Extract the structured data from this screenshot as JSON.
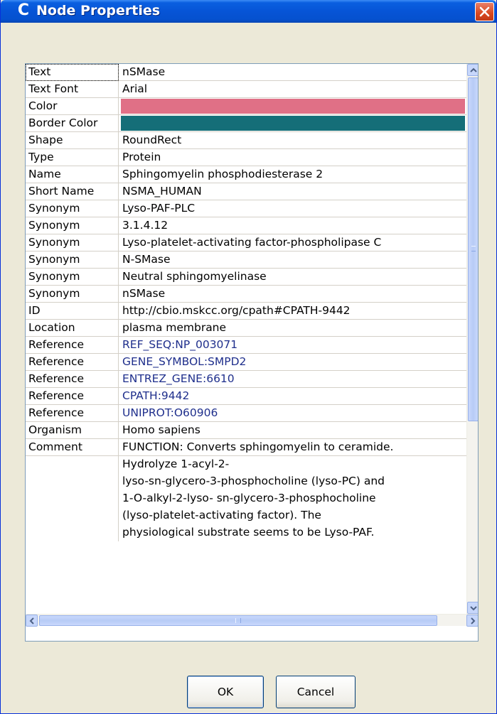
{
  "window": {
    "title": "Node Properties",
    "app_icon_glyph": "C",
    "close_glyph_name": "close-icon"
  },
  "colors": {
    "node_color": "#e07086",
    "border_color": "#156e78",
    "reference_text": "#1f2f8c",
    "titlebar": "#0654d6"
  },
  "properties": [
    {
      "key": "Text",
      "value": "nSMase"
    },
    {
      "key": "Text Font",
      "value": "Arial"
    },
    {
      "key": "Color",
      "value": ""
    },
    {
      "key": "Border Color",
      "value": ""
    },
    {
      "key": "Shape",
      "value": "RoundRect"
    },
    {
      "key": "Type",
      "value": "Protein"
    },
    {
      "key": "Name",
      "value": "Sphingomyelin phosphodiesterase 2"
    },
    {
      "key": "Short Name",
      "value": "NSMA_HUMAN"
    },
    {
      "key": "Synonym",
      "value": "Lyso-PAF-PLC"
    },
    {
      "key": "Synonym",
      "value": "3.1.4.12"
    },
    {
      "key": "Synonym",
      "value": "Lyso-platelet-activating factor-phospholipase C"
    },
    {
      "key": "Synonym",
      "value": "N-SMase"
    },
    {
      "key": "Synonym",
      "value": "Neutral sphingomyelinase"
    },
    {
      "key": "Synonym",
      "value": "nSMase"
    },
    {
      "key": "ID",
      "value": "http://cbio.mskcc.org/cpath#CPATH-9442"
    },
    {
      "key": "Location",
      "value": "plasma membrane"
    },
    {
      "key": "Reference",
      "value": "REF_SEQ:NP_003071"
    },
    {
      "key": "Reference",
      "value": "GENE_SYMBOL:SMPD2"
    },
    {
      "key": "Reference",
      "value": "ENTREZ_GENE:6610"
    },
    {
      "key": "Reference",
      "value": "CPATH:9442"
    },
    {
      "key": "Reference",
      "value": "UNIPROT:O60906"
    },
    {
      "key": "Organism",
      "value": "Homo sapiens"
    },
    {
      "key": "Comment",
      "value": "FUNCTION: Converts sphingomyelin to ceramide."
    }
  ],
  "comment_continuation": [
    "Hydrolyze 1-acyl-2-",
    "lyso-sn-glycero-3-phosphocholine (lyso-PC) and",
    "1-O-alkyl-2-lyso- sn-glycero-3-phosphocholine",
    "(lyso-platelet-activating factor). The",
    "physiological substrate seems to be Lyso-PAF."
  ],
  "buttons": {
    "ok": "OK",
    "cancel": "Cancel"
  }
}
